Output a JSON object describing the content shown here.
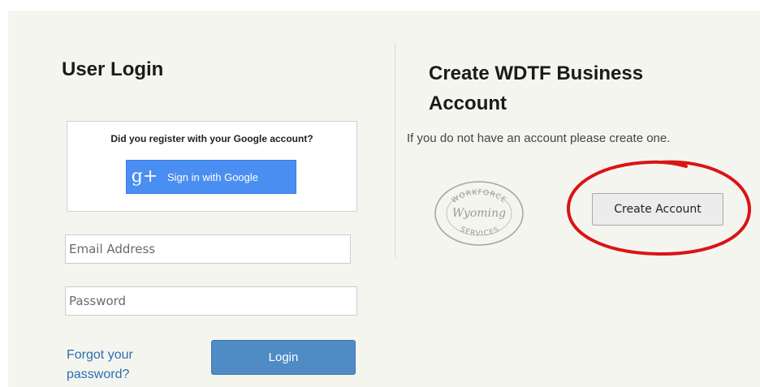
{
  "login": {
    "title": "User Login",
    "google_question": "Did you register with your Google account?",
    "google_button_label": "Sign in with Google",
    "google_icon": "g+",
    "email_placeholder": "Email Address",
    "password_placeholder": "Password",
    "forgot_link": "Forgot your password?",
    "login_button": "Login"
  },
  "create": {
    "title": "Create WDTF Business Account",
    "description": "If you do not have an account please create one.",
    "seal_top": "WORKFORCE",
    "seal_middle": "Wyoming",
    "seal_bottom": "SERVICES",
    "button_label": "Create Account"
  },
  "colors": {
    "panel_background": "#f5f5f0",
    "google_blue": "#4a8ef2",
    "login_blue": "#4f8bc4",
    "link_blue": "#2a6fb0",
    "annotation_red": "#d91515"
  }
}
